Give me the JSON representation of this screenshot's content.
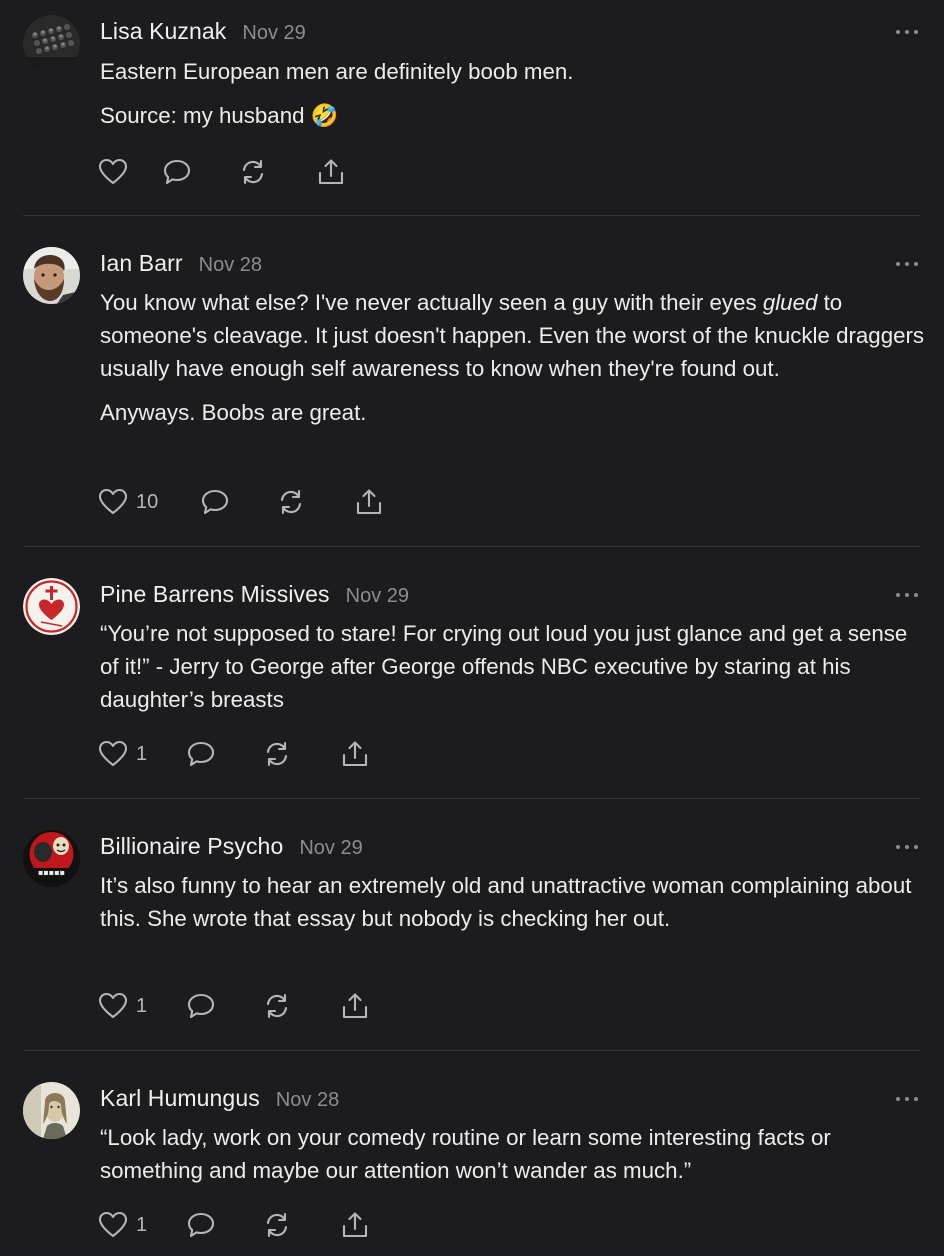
{
  "comments": [
    {
      "author": "Lisa Kuznak",
      "date": "Nov 29",
      "avatar_icon": "typewriter-avatar",
      "paragraphs": [
        "Eastern European men are definitely boob men.",
        "Source: my husband 🤣"
      ],
      "like_count": ""
    },
    {
      "author": "Ian Barr",
      "date": "Nov 28",
      "avatar_icon": "bearded-man-avatar",
      "paragraphs": [
        {
          "before": "You know what else? I've never actually seen a guy with their eyes ",
          "emph": "glued",
          "after": " to someone's cleavage. It just doesn't happen. Even the worst of the knuckle draggers usually have enough self awareness to know when they're found out."
        },
        "Anyways. Boobs are great."
      ],
      "like_count": "10"
    },
    {
      "author": "Pine Barrens Missives",
      "date": "Nov 29",
      "avatar_icon": "sacred-heart-avatar",
      "paragraphs": [
        "“You’re not supposed to stare! For crying out loud you just glance and get a sense of it!” - Jerry to George after George offends NBC executive by staring at his daughter’s breasts"
      ],
      "like_count": "1"
    },
    {
      "author": "Billionaire Psycho",
      "date": "Nov 29",
      "avatar_icon": "red-cartoon-avatar",
      "paragraphs": [
        "It’s also funny to hear an extremely old and unattractive woman complaining about this. She wrote that essay but nobody is checking her out."
      ],
      "like_count": "1"
    },
    {
      "author": "Karl Humungus",
      "date": "Nov 28",
      "avatar_icon": "pale-portrait-avatar",
      "paragraphs": [
        "“Look lady, work on your comedy routine or learn some interesting facts or something and maybe our attention won’t wander as much.”"
      ],
      "like_count": "1"
    }
  ],
  "icons": {
    "like": "heart-icon",
    "reply": "speech-bubble-icon",
    "restack": "restack-arrows-icon",
    "share": "share-upload-icon",
    "more": "more-dots-icon"
  },
  "colors": {
    "background": "#1c1c1e",
    "text": "#ececec",
    "muted": "#8c8c90",
    "divider": "#333336"
  }
}
